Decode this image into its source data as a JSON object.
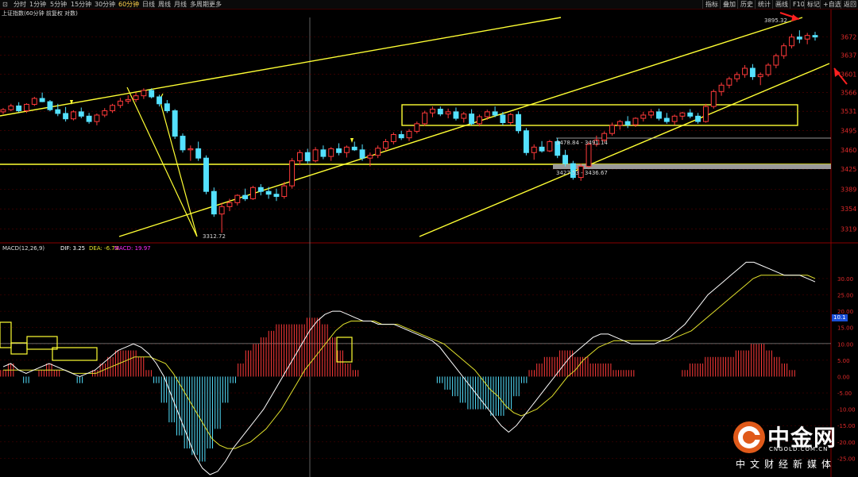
{
  "toolbar": {
    "left": [
      {
        "label": "⊡",
        "active": false
      },
      {
        "label": "分时",
        "active": false
      },
      {
        "label": "1分钟",
        "active": false
      },
      {
        "label": "5分钟",
        "active": false
      },
      {
        "label": "15分钟",
        "active": false
      },
      {
        "label": "30分钟",
        "active": false
      },
      {
        "label": "60分钟",
        "active": true
      },
      {
        "label": "日线",
        "active": false
      },
      {
        "label": "周线",
        "active": false
      },
      {
        "label": "月线",
        "active": false
      },
      {
        "label": "多周期",
        "active": false
      },
      {
        "label": "更多",
        "active": false
      }
    ],
    "right": [
      "指标",
      "叠加",
      "历史",
      "统计",
      "画线",
      "F10",
      "标记",
      "+自选",
      "返回"
    ]
  },
  "main_chart": {
    "title": "上证指数(60分钟 前复权 对数)",
    "high_label": "3895.32",
    "low_label": "3312.72",
    "level_label_1": "3478.84 - 3491.14",
    "level_label_2": "3427.53 - 3436.67"
  },
  "macd_panel": {
    "name": "MACD(12,26,9)",
    "dif": "DIF: 3.25",
    "dea": "DEA: -6.73",
    "macd": "MACD: 19.97",
    "marker": "10.1"
  },
  "logo": {
    "name": "中金网",
    "url_text": "CNGOLD.COM.CN",
    "tagline": "中文财经新媒体"
  },
  "colors": {
    "up": "#ff3a3a",
    "down": "#54e1ff",
    "trendline": "#ffff33",
    "dif": "#ffffff",
    "dea": "#e2e22c",
    "grid": "#5a0000",
    "axis_text": "#e02a2a",
    "arrow": "#ff2020"
  },
  "chart_data": [
    {
      "type": "candlestick",
      "title": "上证指数(60分钟 前复权 对数)",
      "scale": "log",
      "y_ticks": [
        3672,
        3637,
        3601,
        3566,
        3531,
        3495,
        3460,
        3425,
        3389,
        3354,
        3319
      ],
      "ylim": [
        3300,
        3710
      ],
      "candles": [
        [
          3530,
          3537,
          3526,
          3534
        ],
        [
          3534,
          3545,
          3531,
          3541
        ],
        [
          3541,
          3548,
          3529,
          3532
        ],
        [
          3532,
          3546,
          3528,
          3544
        ],
        [
          3544,
          3558,
          3541,
          3555
        ],
        [
          3555,
          3566,
          3548,
          3549
        ],
        [
          3549,
          3552,
          3531,
          3534
        ],
        [
          3534,
          3545,
          3522,
          3527
        ],
        [
          3527,
          3539,
          3512,
          3517
        ],
        [
          3517,
          3533,
          3514,
          3530
        ],
        [
          3530,
          3538,
          3518,
          3522
        ],
        [
          3522,
          3528,
          3508,
          3512
        ],
        [
          3512,
          3527,
          3505,
          3524
        ],
        [
          3524,
          3537,
          3520,
          3532
        ],
        [
          3532,
          3545,
          3528,
          3542
        ],
        [
          3542,
          3556,
          3537,
          3550
        ],
        [
          3550,
          3561,
          3545,
          3553
        ],
        [
          3553,
          3566,
          3548,
          3560
        ],
        [
          3560,
          3574,
          3554,
          3570
        ],
        [
          3570,
          3574,
          3555,
          3558
        ],
        [
          3558,
          3562,
          3540,
          3545
        ],
        [
          3545,
          3552,
          3528,
          3532
        ],
        [
          3532,
          3535,
          3480,
          3485
        ],
        [
          3485,
          3490,
          3455,
          3460
        ],
        [
          3460,
          3468,
          3440,
          3462
        ],
        [
          3462,
          3475,
          3440,
          3445
        ],
        [
          3445,
          3450,
          3380,
          3385
        ],
        [
          3385,
          3392,
          3340,
          3345
        ],
        [
          3345,
          3365,
          3312,
          3358
        ],
        [
          3358,
          3372,
          3350,
          3365
        ],
        [
          3365,
          3380,
          3360,
          3378
        ],
        [
          3378,
          3390,
          3368,
          3372
        ],
        [
          3372,
          3395,
          3370,
          3392
        ],
        [
          3392,
          3398,
          3378,
          3385
        ],
        [
          3385,
          3393,
          3372,
          3380
        ],
        [
          3380,
          3390,
          3368,
          3376
        ],
        [
          3376,
          3402,
          3372,
          3395
        ],
        [
          3395,
          3445,
          3390,
          3440
        ],
        [
          3440,
          3460,
          3432,
          3455
        ],
        [
          3455,
          3462,
          3435,
          3440
        ],
        [
          3440,
          3465,
          3437,
          3460
        ],
        [
          3460,
          3468,
          3443,
          3448
        ],
        [
          3448,
          3465,
          3440,
          3462
        ],
        [
          3462,
          3472,
          3450,
          3455
        ],
        [
          3455,
          3468,
          3446,
          3465
        ],
        [
          3465,
          3475,
          3458,
          3460
        ],
        [
          3460,
          3470,
          3440,
          3445
        ],
        [
          3445,
          3455,
          3430,
          3450
        ],
        [
          3450,
          3468,
          3445,
          3463
        ],
        [
          3463,
          3480,
          3458,
          3475
        ],
        [
          3475,
          3492,
          3470,
          3488
        ],
        [
          3488,
          3495,
          3478,
          3482
        ],
        [
          3482,
          3498,
          3476,
          3494
        ],
        [
          3494,
          3512,
          3490,
          3508
        ],
        [
          3508,
          3532,
          3504,
          3528
        ],
        [
          3528,
          3540,
          3520,
          3535
        ],
        [
          3535,
          3540,
          3522,
          3526
        ],
        [
          3526,
          3536,
          3518,
          3530
        ],
        [
          3530,
          3538,
          3514,
          3518
        ],
        [
          3518,
          3530,
          3510,
          3526
        ],
        [
          3526,
          3535,
          3505,
          3508
        ],
        [
          3508,
          3525,
          3503,
          3521
        ],
        [
          3521,
          3534,
          3515,
          3530
        ],
        [
          3530,
          3540,
          3520,
          3524
        ],
        [
          3524,
          3530,
          3505,
          3510
        ],
        [
          3510,
          3528,
          3506,
          3525
        ],
        [
          3525,
          3531,
          3490,
          3495
        ],
        [
          3495,
          3500,
          3450,
          3455
        ],
        [
          3455,
          3470,
          3442,
          3465
        ],
        [
          3465,
          3476,
          3455,
          3458
        ],
        [
          3458,
          3478,
          3456,
          3475
        ],
        [
          3475,
          3482,
          3445,
          3450
        ],
        [
          3450,
          3460,
          3430,
          3435
        ],
        [
          3435,
          3440,
          3406,
          3410
        ],
        [
          3410,
          3435,
          3404,
          3430
        ],
        [
          3430,
          3475,
          3428,
          3470
        ],
        [
          3470,
          3486,
          3466,
          3478
        ],
        [
          3478,
          3494,
          3474,
          3490
        ],
        [
          3490,
          3510,
          3486,
          3505
        ],
        [
          3505,
          3515,
          3497,
          3512
        ],
        [
          3512,
          3522,
          3500,
          3506
        ],
        [
          3506,
          3520,
          3502,
          3518
        ],
        [
          3518,
          3530,
          3512,
          3524
        ],
        [
          3524,
          3535,
          3518,
          3530
        ],
        [
          3530,
          3536,
          3514,
          3518
        ],
        [
          3518,
          3528,
          3508,
          3512
        ],
        [
          3512,
          3525,
          3506,
          3522
        ],
        [
          3522,
          3530,
          3515,
          3528
        ],
        [
          3528,
          3535,
          3518,
          3522
        ],
        [
          3522,
          3528,
          3508,
          3512
        ],
        [
          3512,
          3545,
          3510,
          3540
        ],
        [
          3540,
          3572,
          3536,
          3568
        ],
        [
          3568,
          3585,
          3560,
          3580
        ],
        [
          3580,
          3596,
          3574,
          3592
        ],
        [
          3592,
          3605,
          3586,
          3600
        ],
        [
          3600,
          3618,
          3594,
          3612
        ],
        [
          3612,
          3620,
          3590,
          3596
        ],
        [
          3596,
          3604,
          3580,
          3600
        ],
        [
          3600,
          3622,
          3596,
          3618
        ],
        [
          3618,
          3640,
          3612,
          3636
        ],
        [
          3636,
          3660,
          3630,
          3655
        ],
        [
          3655,
          3678,
          3650,
          3672
        ],
        [
          3672,
          3685,
          3660,
          3668
        ],
        [
          3668,
          3680,
          3658,
          3675
        ],
        [
          3675,
          3682,
          3665,
          3672
        ]
      ],
      "annotations": [
        "3895.32",
        "3312.72",
        "3478.84 - 3491.14",
        "3427.53 - 3436.67"
      ]
    },
    {
      "type": "macd",
      "title": "MACD(12,26,9)",
      "y_ticks": [
        30.0,
        25.0,
        20.0,
        15.0,
        10.0,
        5.0,
        0.0,
        -5.0,
        -10.0,
        -15.0,
        -20.0,
        -25.0
      ],
      "ylim": [
        -30,
        38
      ],
      "dif": [
        3,
        4,
        2,
        1,
        2,
        3,
        4,
        3,
        2,
        1,
        0,
        1,
        2,
        4,
        6,
        8,
        9,
        10,
        9,
        7,
        4,
        0,
        -6,
        -12,
        -18,
        -24,
        -28,
        -30,
        -29,
        -26,
        -22,
        -19,
        -16,
        -13,
        -10,
        -6,
        -2,
        2,
        6,
        10,
        14,
        17,
        19,
        20,
        20,
        19,
        18,
        17,
        17,
        16,
        16,
        16,
        15,
        14,
        13,
        12,
        11,
        9,
        6,
        3,
        0,
        -3,
        -6,
        -9,
        -12,
        -15,
        -17,
        -15,
        -12,
        -9,
        -6,
        -3,
        0,
        3,
        6,
        8,
        10,
        12,
        13,
        13,
        12,
        11,
        10,
        10,
        10,
        10,
        11,
        12,
        14,
        16,
        19,
        22,
        25,
        27,
        29,
        31,
        33,
        35,
        35,
        34,
        33,
        32,
        31,
        31,
        31,
        30,
        29
      ],
      "dea": [
        2,
        2,
        2,
        2,
        2,
        2,
        2,
        2,
        2,
        1,
        1,
        1,
        1,
        2,
        3,
        4,
        5,
        6,
        6,
        6,
        5,
        4,
        1,
        -3,
        -7,
        -11,
        -15,
        -19,
        -21,
        -22,
        -22,
        -21,
        -20,
        -18,
        -16,
        -13,
        -10,
        -6,
        -2,
        2,
        5,
        8,
        11,
        14,
        16,
        17,
        17,
        17,
        17,
        16,
        16,
        16,
        15,
        14,
        13,
        12,
        11,
        10,
        8,
        6,
        4,
        2,
        -1,
        -4,
        -6,
        -9,
        -11,
        -12,
        -11,
        -10,
        -8,
        -6,
        -3,
        0,
        2,
        5,
        7,
        9,
        10,
        11,
        11,
        11,
        11,
        11,
        11,
        11,
        11,
        12,
        13,
        14,
        16,
        18,
        20,
        22,
        24,
        26,
        28,
        30,
        31,
        31,
        31,
        31,
        31,
        31,
        31,
        30
      ],
      "macd_hist": [
        2,
        4,
        0,
        -2,
        0,
        2,
        4,
        2,
        0,
        0,
        -2,
        0,
        2,
        4,
        6,
        8,
        8,
        8,
        6,
        2,
        -2,
        -8,
        -14,
        -18,
        -22,
        -24,
        -26,
        -22,
        -16,
        -8,
        -2,
        4,
        8,
        10,
        12,
        14,
        16,
        16,
        16,
        16,
        18,
        18,
        16,
        12,
        8,
        4,
        2,
        0,
        0,
        0,
        0,
        0,
        0,
        0,
        0,
        0,
        0,
        -2,
        -4,
        -6,
        -8,
        -10,
        -10,
        -10,
        -12,
        -12,
        -10,
        -6,
        -2,
        2,
        4,
        6,
        6,
        8,
        8,
        6,
        6,
        4,
        4,
        4,
        2,
        2,
        2,
        0,
        0,
        0,
        0,
        0,
        0,
        2,
        4,
        4,
        6,
        6,
        6,
        6,
        8,
        8,
        10,
        10,
        8,
        6,
        4,
        2,
        0,
        0,
        0
      ]
    }
  ]
}
